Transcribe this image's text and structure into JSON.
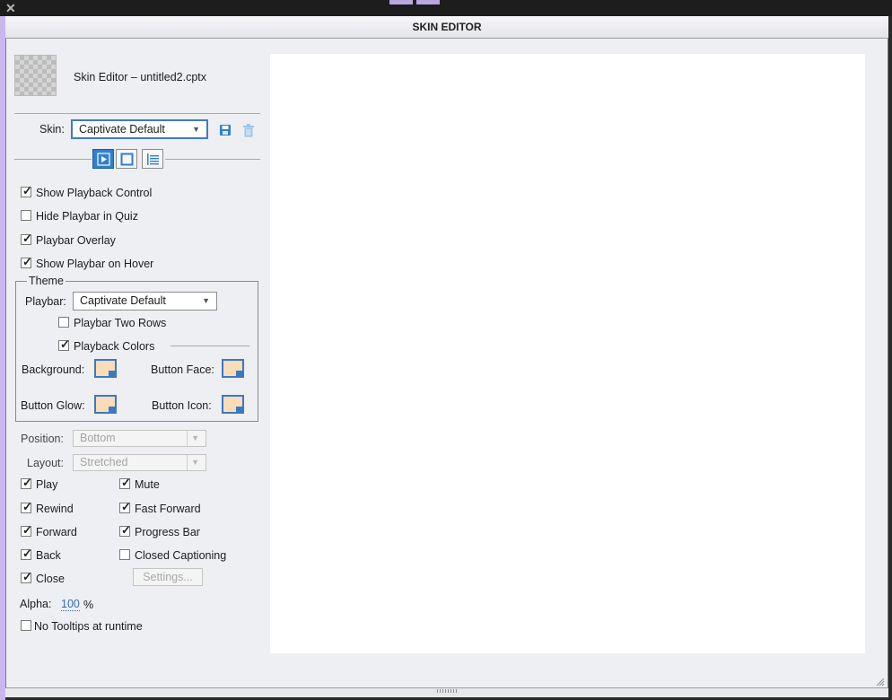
{
  "window": {
    "title": "SKIN EDITOR",
    "close_glyph": "✕"
  },
  "header": {
    "project_label": "Skin Editor – untitled2.cptx"
  },
  "skin": {
    "label": "Skin:",
    "selected": "Captivate Default"
  },
  "tabs": [
    {
      "name": "playback-tab",
      "icon": "play-icon",
      "active": true
    },
    {
      "name": "borders-tab",
      "icon": "square-icon",
      "active": false
    },
    {
      "name": "toc-tab",
      "icon": "list-icon",
      "active": false
    }
  ],
  "options": {
    "show_playback_control": {
      "label": "Show Playback Control",
      "checked": true
    },
    "hide_playbar_in_quiz": {
      "label": "Hide Playbar in Quiz",
      "checked": false
    },
    "playbar_overlay": {
      "label": "Playbar Overlay",
      "checked": true
    },
    "show_playbar_on_hover": {
      "label": "Show Playbar on Hover",
      "checked": true
    }
  },
  "theme": {
    "legend": "Theme",
    "playbar_label": "Playbar:",
    "playbar_selected": "Captivate Default",
    "two_rows": {
      "label": "Playbar Two Rows",
      "checked": false
    },
    "colors": {
      "label": "Playback Colors",
      "checked": true
    },
    "background_label": "Background:",
    "button_face_label": "Button Face:",
    "button_glow_label": "Button Glow:",
    "button_icon_label": "Button Icon:",
    "swatch_color": "#fbdcb8",
    "swatch_border": "#3b79c4"
  },
  "position": {
    "label": "Position:",
    "selected": "Bottom"
  },
  "layout": {
    "label": "Layout:",
    "selected": "Stretched"
  },
  "controls": {
    "play": {
      "label": "Play",
      "checked": true
    },
    "mute": {
      "label": "Mute",
      "checked": true
    },
    "rewind": {
      "label": "Rewind",
      "checked": true
    },
    "fast_forward": {
      "label": "Fast Forward",
      "checked": true
    },
    "forward": {
      "label": "Forward",
      "checked": true
    },
    "progress_bar": {
      "label": "Progress Bar",
      "checked": true
    },
    "back": {
      "label": "Back",
      "checked": true
    },
    "closed_captioning": {
      "label": "Closed Captioning",
      "checked": false
    },
    "close": {
      "label": "Close",
      "checked": true
    }
  },
  "settings_button": "Settings...",
  "alpha": {
    "label": "Alpha:",
    "value": "100",
    "unit": "%"
  },
  "no_tooltips": {
    "label": "No Tooltips at runtime",
    "checked": false
  },
  "accent_color": "#2f80cf"
}
